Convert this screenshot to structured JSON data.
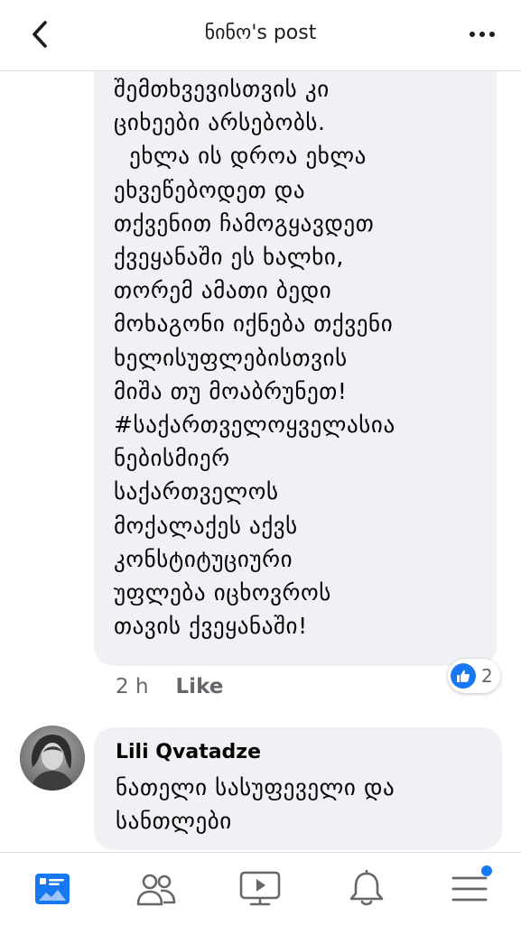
{
  "header": {
    "title": "ნინო's post",
    "back_icon": "chevron-left-icon",
    "more_icon": "more-horizontal-icon"
  },
  "comment_1": {
    "text": "შემთხვევისთვის კი\nციხეები არსებობს.\n  ეხლა ის დროა ეხლა\nეხვეწებოდეთ და\nთქვენით ჩამოგყავდეთ\nქვეყანაში ეს ხალხი,\nთორემ ამათი ბედი\nმოხაგონი იქნება თქვენი\nხელისუფლებისთვის\nმიშა თუ მოაბრუნეთ!\n#საქართველოყველასია\nნებისმიერ\nსაქართველოს\nმოქალაქეს აქვს\nკონსტიტუციური\nუფლება იცხოვროს\nთავის ქვეყანაში!",
    "time": "2 h",
    "like_label": "Like",
    "reaction_count": "2",
    "reaction_icon": "like-thumb-icon"
  },
  "comment_2": {
    "author": "Lili Qvatadze",
    "text": "ნათელი სასუფეველი და\nსანთლები",
    "avatar_icon": "avatar-photo"
  },
  "tabbar": {
    "items": [
      {
        "icon": "news-feed-icon",
        "active": true
      },
      {
        "icon": "groups-icon",
        "active": false
      },
      {
        "icon": "watch-icon",
        "active": false
      },
      {
        "icon": "notifications-icon",
        "active": false
      },
      {
        "icon": "menu-icon",
        "active": false,
        "badge_dot": true
      }
    ]
  },
  "colors": {
    "accent": "#1877f2",
    "bubble": "#eff1f5",
    "icon_gray": "#65676b",
    "divider": "#dadde1"
  }
}
